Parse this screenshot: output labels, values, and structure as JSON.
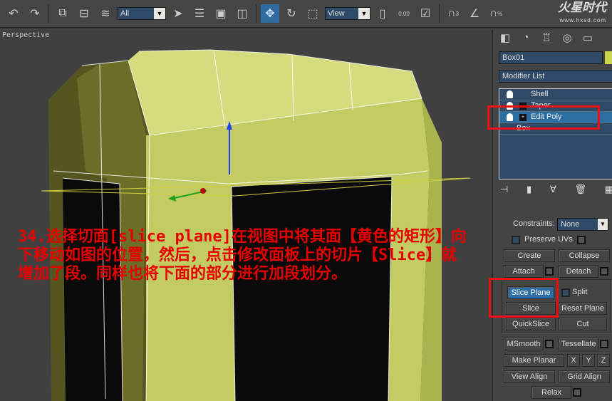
{
  "toolbar": {
    "selection_filter": "All",
    "coord_system": "View",
    "spinner_snap_value": "0.00",
    "snap_3": "3",
    "snap_percent": "%"
  },
  "logo": {
    "title": "火星时代",
    "url": "www.hxsd.com"
  },
  "viewport": {
    "label": "Perspective",
    "caption": "34.选择切面[slice plane]在视图中将其面【黄色的矩形】向下移动如图的位置，然后，点击修改面板上的切片【Slice】就增加了段。同样也将下面的部分进行加段划分。"
  },
  "panel": {
    "object_name": "Box01",
    "object_color": "#c8d84a",
    "modifier_list": "Modifier List",
    "stack": [
      {
        "label": "Shell"
      },
      {
        "label": "Taper"
      },
      {
        "label": "Edit Poly",
        "selected": true
      },
      {
        "label": "Box"
      }
    ],
    "constraints_label": "Constraints:",
    "constraints_value": "None",
    "preserve_uvs": "Preserve UVs",
    "buttons": {
      "create": "Create",
      "collapse": "Collapse",
      "attach": "Attach",
      "detach": "Detach",
      "slice_plane": "Slice Plane",
      "split": "Split",
      "slice": "Slice",
      "reset_plane": "Reset Plane",
      "quickslice": "QuickSlice",
      "cut": "Cut",
      "msmooth": "MSmooth",
      "tessellate": "Tessellate",
      "make_planar": "Make Planar",
      "x": "X",
      "y": "Y",
      "z": "Z",
      "view_align": "View Align",
      "grid_align": "Grid Align",
      "relax": "Relax"
    }
  },
  "colors": {
    "highlight": "#ee1010",
    "caption": "#e80000",
    "selection": "#2f6ea4"
  }
}
